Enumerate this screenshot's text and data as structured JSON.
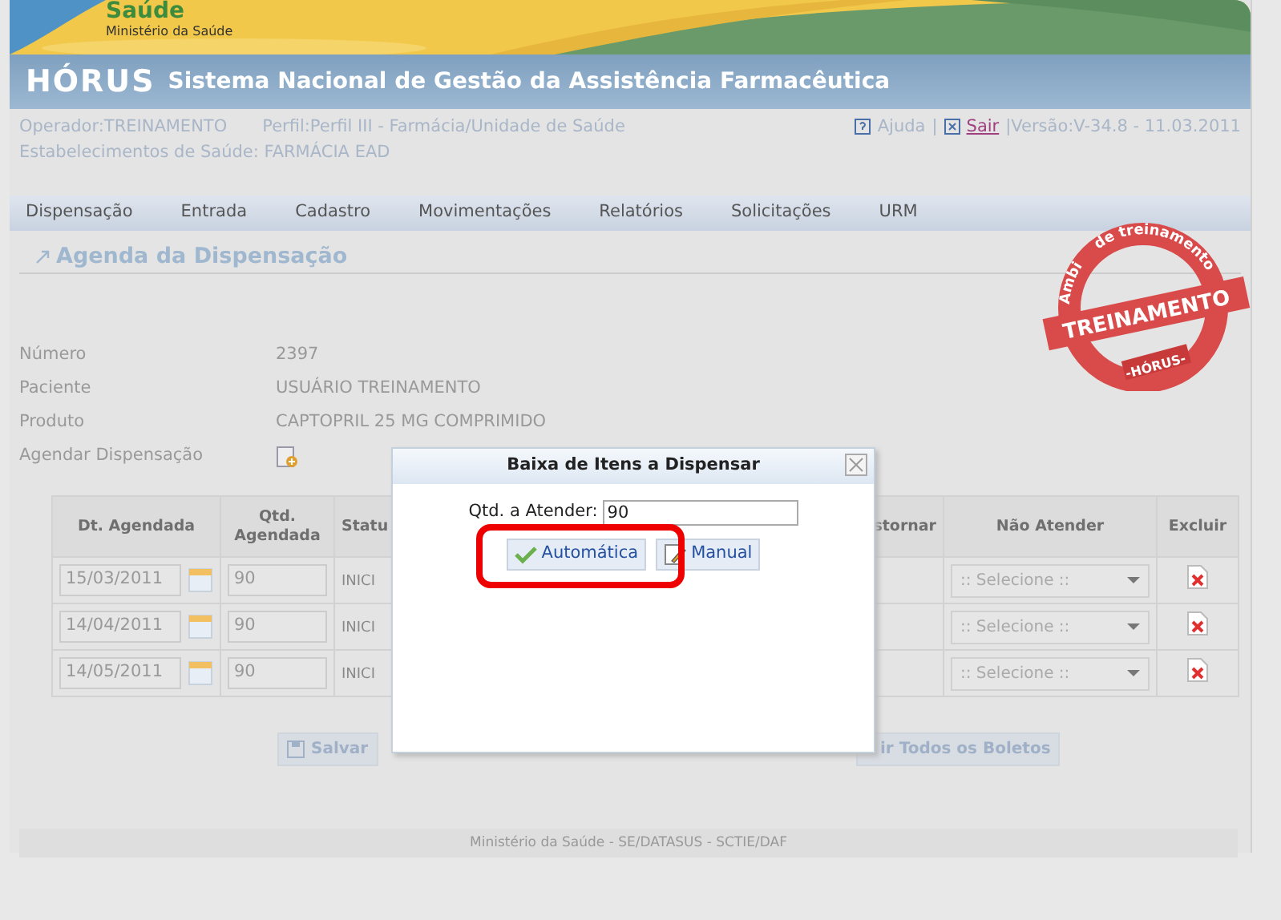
{
  "banner": {
    "logo_title": "Saúde",
    "logo_subtitle": "Ministério da Saúde"
  },
  "title_bar": {
    "app_name": "HÓRUS",
    "app_subtitle": "Sistema Nacional de Gestão da Assistência Farmacêutica"
  },
  "user_info": {
    "operator": "Operador:TREINAMENTO",
    "profile": "Perfil:Perfil III - Farmácia/Unidade de Saúde",
    "establishment": "Estabelecimentos de Saúde: FARMÁCIA EAD",
    "help_link": "Ajuda",
    "separator": "|",
    "exit_link": "Sair",
    "version": "|Versão:V-34.8 - 11.03.2011"
  },
  "menu": [
    "Dispensação",
    "Entrada",
    "Cadastro",
    "Movimentações",
    "Relatórios",
    "Solicitações",
    "URM"
  ],
  "section_title": "Agenda da Dispensação",
  "stamp": {
    "arc_text": "de treinamento",
    "side_text": "Ambi",
    "ribbon": "TREINAMENTO",
    "bottom": "-HÓRUS-"
  },
  "fields": [
    {
      "kind": "text",
      "label": "Número",
      "value": "2397"
    },
    {
      "kind": "text",
      "label": "Paciente",
      "value": "USUÁRIO TREINAMENTO"
    },
    {
      "kind": "text",
      "label": "Produto",
      "value": "CAPTOPRIL 25 MG COMPRIMIDO"
    },
    {
      "kind": "action",
      "label": "Agendar Dispensação"
    }
  ],
  "table": {
    "columns": [
      "Dt. Agendada",
      "Qtd. Agendada",
      "Statu",
      "stornar",
      "Não Atender",
      "Excluir"
    ],
    "rows": [
      {
        "date": "15/03/2011",
        "qty": "90",
        "status": "INICI",
        "select": ":: Selecione ::"
      },
      {
        "date": "14/04/2011",
        "qty": "90",
        "status": "INICI",
        "select": ":: Selecione ::"
      },
      {
        "date": "14/05/2011",
        "qty": "90",
        "status": "INICI",
        "select": ":: Selecione ::"
      }
    ]
  },
  "buttons": [
    {
      "kind": "save",
      "label": "Salvar"
    },
    {
      "kind": "plain",
      "label": "ir Todos os Boletos"
    }
  ],
  "footer": "Ministério da Saúde - SE/DATASUS - SCTIE/DAF",
  "dialog": {
    "title": "Baixa de Itens a Dispensar",
    "qty_label": "Qtd. a Atender:",
    "qty_value": "90",
    "buttons": [
      {
        "kind": "auto",
        "label": "Automática",
        "highlighted": true
      },
      {
        "kind": "manual",
        "label": "Manual",
        "highlighted": false
      }
    ]
  }
}
